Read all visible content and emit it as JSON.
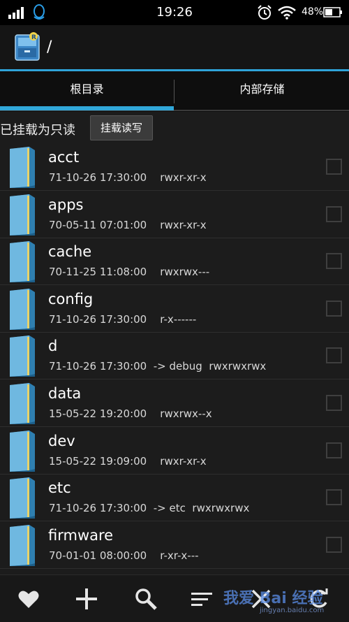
{
  "status_bar": {
    "time": "19:26",
    "battery": "48%",
    "icons": [
      "signal-icon",
      "qq-icon",
      "alarm-icon",
      "wifi-icon",
      "battery-icon"
    ]
  },
  "header": {
    "path": "/",
    "logo_icon": "root-explorer-logo"
  },
  "tabs": [
    {
      "label": "根目录",
      "active": true
    },
    {
      "label": "内部存储",
      "active": false
    }
  ],
  "mount": {
    "status": "已挂载为只读",
    "button_label": "挂载读写"
  },
  "files": [
    {
      "name": "acct",
      "meta": "71-10-26 17:30:00    rwxr-xr-x"
    },
    {
      "name": "apps",
      "meta": "70-05-11 07:01:00    rwxr-xr-x"
    },
    {
      "name": "cache",
      "meta": "70-11-25 11:08:00    rwxrwx---"
    },
    {
      "name": "config",
      "meta": "71-10-26 17:30:00    r-x------"
    },
    {
      "name": "d",
      "meta": "71-10-26 17:30:00  -> debug  rwxrwxrwx"
    },
    {
      "name": "data",
      "meta": "15-05-22 19:20:00    rwxrwx--x"
    },
    {
      "name": "dev",
      "meta": "15-05-22 19:09:00    rwxr-xr-x"
    },
    {
      "name": "etc",
      "meta": "71-10-26 17:30:00  -> etc  rwxrwxrwx"
    },
    {
      "name": "firmware",
      "meta": "70-01-01 08:00:00    r-xr-x---"
    }
  ],
  "toolbar": {
    "icons": [
      "heart-icon",
      "plus-icon",
      "search-icon",
      "sort-icon",
      "close-icon",
      "refresh-icon"
    ]
  },
  "watermark": {
    "text": "我爱 Bai 经验",
    "sub": "jingyan.baidu.com"
  },
  "colors": {
    "accent": "#31a7d9",
    "background": "#1c1c1c",
    "folder": "#3a8fbf"
  }
}
